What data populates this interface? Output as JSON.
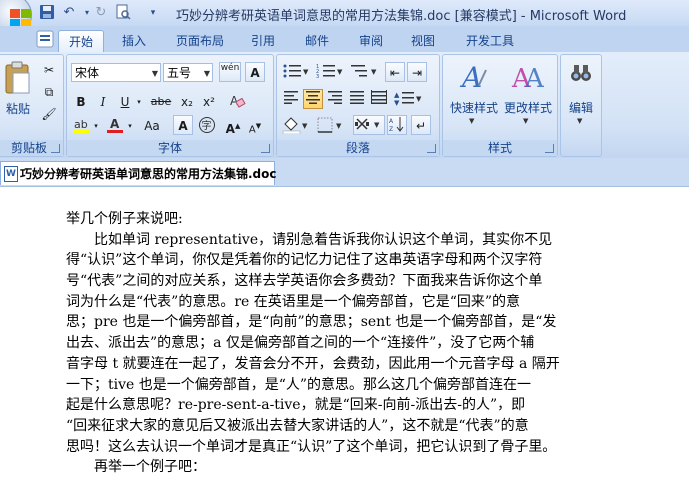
{
  "window": {
    "title": "巧妙分辨考研英语单词意思的常用方法集锦.doc [兼容模式] - Microsoft Word"
  },
  "quick_access": {
    "save": "save-icon",
    "undo": "undo-icon",
    "redo": "redo-icon",
    "print_preview": "print-preview-icon",
    "customize": "customize-icon"
  },
  "tabs": [
    "开始",
    "插入",
    "页面布局",
    "引用",
    "邮件",
    "审阅",
    "视图",
    "开发工具"
  ],
  "active_tab": "开始",
  "ribbon": {
    "clipboard": {
      "label": "剪贴板",
      "paste_label": "粘贴"
    },
    "font": {
      "label": "字体",
      "font_name": "宋体",
      "font_size": "五号",
      "pinyin_btn": "wén",
      "bold": "B",
      "italic": "I",
      "underline": "U",
      "strike": "abe",
      "subscript": "x₂",
      "superscript": "x²",
      "grow": "A",
      "shrink": "A",
      "change_case": "Aa",
      "char_shade": "A",
      "enclose": "字"
    },
    "paragraph": {
      "label": "段落"
    },
    "styles": {
      "label": "样式",
      "quick_styles": "快速样式",
      "change_styles": "更改样式"
    },
    "editing": {
      "label": "编辑",
      "editing_btn": "编辑"
    }
  },
  "document": {
    "tab_name": "巧妙分辨考研英语单词意思的常用方法集锦.doc",
    "lines": [
      "举几个例子来说吧:",
      "　　比如单词 representative，请别急着告诉我你认识这个单词，其实你不见",
      "得“认识”这个单词，你仅是凭着你的记忆力记住了这串英语字母和两个汉字符",
      "号“代表”之间的对应关系，这样去学英语你会多费劲？下面我来告诉你这个单",
      "词为什么是“代表”的意思。re 在英语里是一个偏旁部首，它是“回来”的意",
      "思；pre 也是一个偏旁部首，是“向前”的意思；sent 也是一个偏旁部首，是“发",
      "出去、派出去”的意思；a 仅是偏旁部首之间的一个“连接件”，没了它两个辅",
      "音字母 t 就要连在一起了，发音会分不开，会费劲，因此用一个元音字母 a 隔开",
      "一下；tive 也是一个偏旁部首，是“人”的意思。那么这几个偏旁部首连在一",
      "起是什么意思呢？re-pre-sent-a-tive，就是“回来-向前-派出去-的人”，即",
      "“回来征求大家的意见后又被派出去替大家讲话的人”，这不就是“代表”的意",
      "思吗！这么去认识一个单词才是真正“认识”了这个单词，把它认识到了骨子里。",
      "　　再举一个例子吧："
    ]
  },
  "colors": {
    "ribbon_bg": "#d3e2f6",
    "label_text": "#15428b",
    "active_button": "#ffd56b",
    "font_color_bar": "#e02020",
    "highlight_bar": "#ffff00"
  }
}
